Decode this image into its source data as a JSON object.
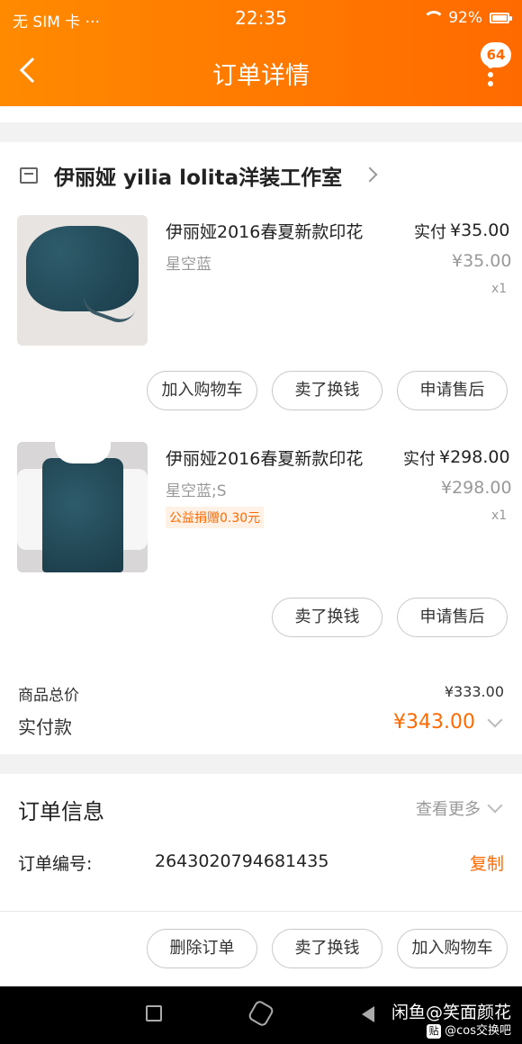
{
  "status_bar": {
    "carrier": "无 SIM 卡 ···",
    "time": "22:35",
    "battery": "92%"
  },
  "nav": {
    "title": "订单详情",
    "badge": "64"
  },
  "store": {
    "name": "伊丽娅 yilia  lolita洋装工作室"
  },
  "items": [
    {
      "title": "伊丽娅2016春夏新款印花",
      "sku": "星空蓝",
      "pay_label": "实付",
      "pay_price": "¥35.00",
      "orig_price": "¥35.00",
      "qty": "x1",
      "actions": [
        "加入购物车",
        "卖了换钱",
        "申请售后"
      ]
    },
    {
      "title": "伊丽娅2016春夏新款印花",
      "sku": "星空蓝;S",
      "charity": "公益捐赠0.30元",
      "pay_label": "实付",
      "pay_price": "¥298.00",
      "orig_price": "¥298.00",
      "qty": "x1",
      "actions": [
        "卖了换钱",
        "申请售后"
      ]
    }
  ],
  "totals": {
    "goods_label": "商品总价",
    "goods_value": "¥333.00",
    "paid_label": "实付款",
    "paid_value": "¥343.00"
  },
  "order_info": {
    "title": "订单信息",
    "see_more": "查看更多",
    "number_label": "订单编号:",
    "number": "2643020794681435",
    "copy": "复制"
  },
  "bottom_actions": [
    "删除订单",
    "卖了换钱",
    "加入购物车"
  ],
  "watermark": {
    "main": "闲鱼@笑面颜花",
    "sub_icon": "贴",
    "sub": "@cos交换吧"
  },
  "colors": {
    "accent": "#ff6a00"
  }
}
